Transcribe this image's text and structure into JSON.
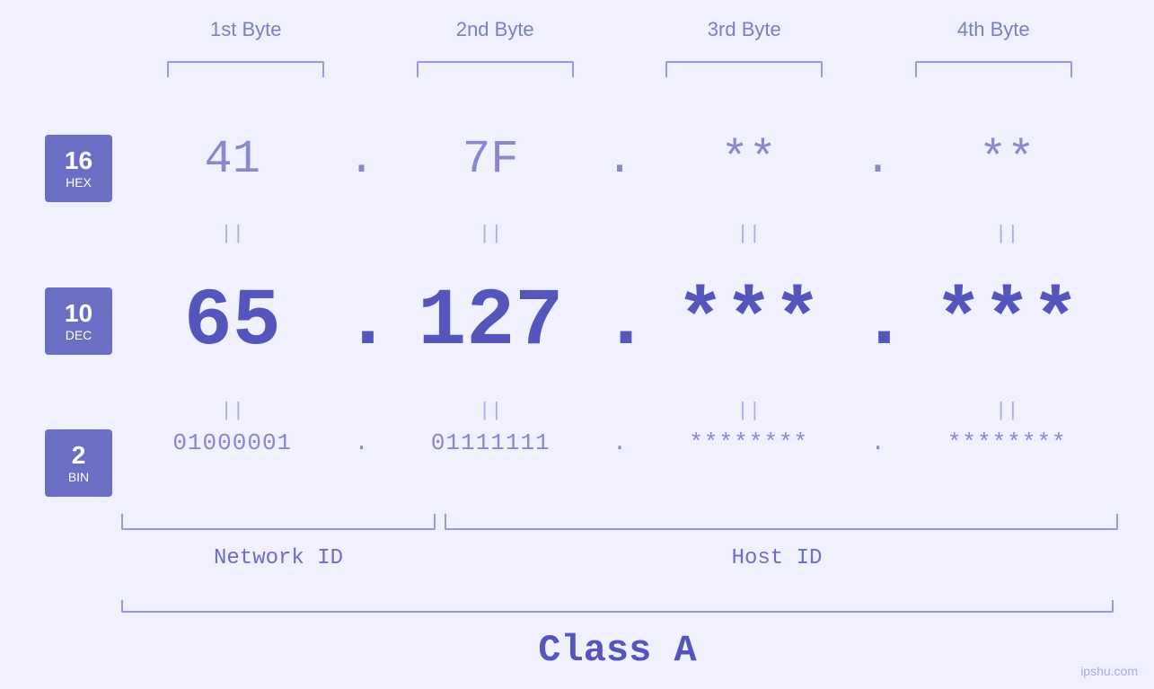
{
  "byteHeaders": [
    {
      "label": "1st Byte"
    },
    {
      "label": "2nd Byte"
    },
    {
      "label": "3rd Byte"
    },
    {
      "label": "4th Byte"
    }
  ],
  "bases": [
    {
      "num": "16",
      "label": "HEX"
    },
    {
      "num": "10",
      "label": "DEC"
    },
    {
      "num": "2",
      "label": "BIN"
    }
  ],
  "hexRow": {
    "b1": "41",
    "b2": "7F",
    "b3": "**",
    "b4": "**",
    "dot": "."
  },
  "decRow": {
    "b1": "65",
    "b2": "127",
    "b3": "***",
    "b4": "***",
    "dot": "."
  },
  "binRow": {
    "b1": "01000001",
    "b2": "01111111",
    "b3": "********",
    "b4": "********",
    "dot": "."
  },
  "equalsSymbol": "||",
  "networkId": "Network ID",
  "hostId": "Host ID",
  "classLabel": "Class A",
  "watermark": "ipshu.com"
}
